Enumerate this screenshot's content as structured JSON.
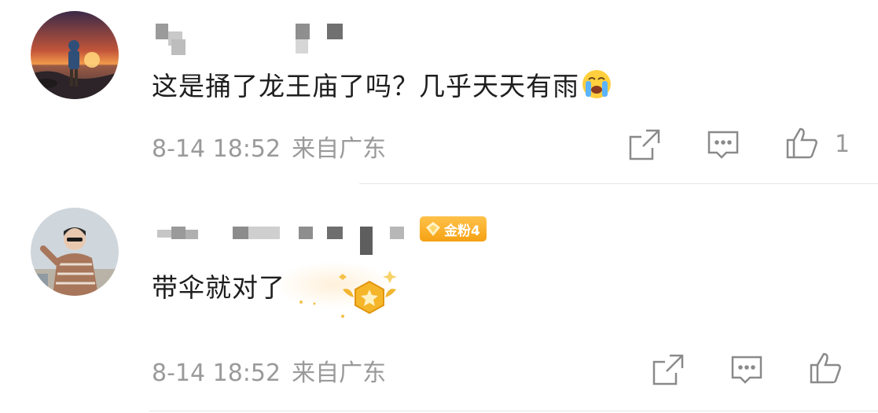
{
  "comments": [
    {
      "text": "这是捅了龙王庙了吗？几乎天天有雨",
      "emoji": "crying-face-icon",
      "date": "8-14 18:52",
      "location": "来自广东",
      "likes": "1"
    },
    {
      "badge": "金粉4",
      "text": "带伞就对了",
      "date": "8-14 18:52",
      "location": "来自广东"
    }
  ],
  "colors": {
    "text": "#1e1e1e",
    "meta": "#9a9a9a",
    "badge": "#f5a214",
    "icon": "#8a8a8a"
  }
}
